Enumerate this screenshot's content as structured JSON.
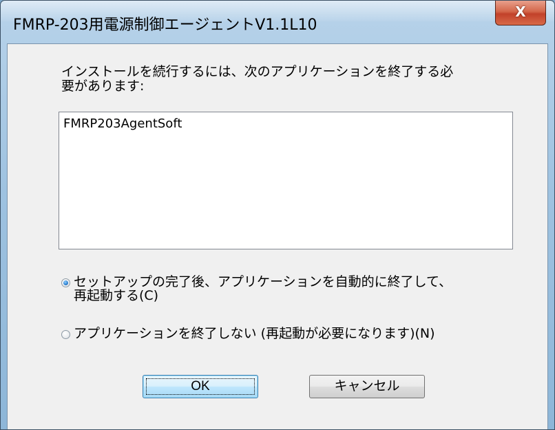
{
  "window": {
    "title": "FMRP-203用電源制御エージェントV1.1L10",
    "close_label": "X"
  },
  "dialog": {
    "message": "インストールを続行するには、次のアプリケーションを終了する必\n要があります:",
    "applications": [
      "FMRP203AgentSoft"
    ],
    "options": [
      {
        "label": "セットアップの完了後、アプリケーションを自動的に終了して、\n再起動する(C)",
        "selected": true
      },
      {
        "label": "アプリケーションを終了しない (再起動が必要になります)(N)",
        "selected": false
      }
    ],
    "ok_label": "OK",
    "cancel_label": "キャンセル"
  },
  "colors": {
    "title_bar": "#9ec2e0",
    "close_button": "#c2412a",
    "dialog_bg": "#f0f0f0",
    "default_button": "#bee6fd",
    "radio_selected": "#2d7fd0"
  }
}
